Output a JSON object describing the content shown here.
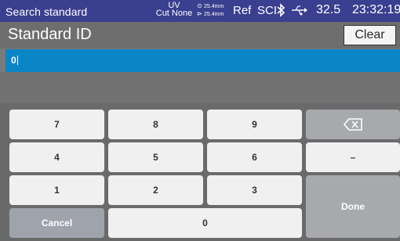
{
  "status": {
    "screen_title": "Search standard",
    "uv_label": "UV",
    "cut_label": "Cut None",
    "laser_top": "25.4mm",
    "laser_bottom": "25.4mm",
    "ref_label": "Ref",
    "sci_label": "SCI",
    "bluetooth_icon": "bluetooth-icon",
    "usb_icon": "usb-icon",
    "temperature": "32.5",
    "clock": "23:32:19"
  },
  "header": {
    "title": "Standard ID",
    "clear_label": "Clear"
  },
  "field": {
    "value": "0"
  },
  "keypad": {
    "k7": "7",
    "k8": "8",
    "k9": "9",
    "k4": "4",
    "k5": "5",
    "k6": "6",
    "k1": "1",
    "k2": "2",
    "k3": "3",
    "k0": "0",
    "minus": "–",
    "cancel": "Cancel",
    "done": "Done",
    "backspace_icon": "backspace-icon"
  },
  "colors": {
    "statusbar": "#3a3f8f",
    "field": "#0a86c6",
    "key": "#f0f0f0",
    "side_key": "#a7a9ad"
  }
}
